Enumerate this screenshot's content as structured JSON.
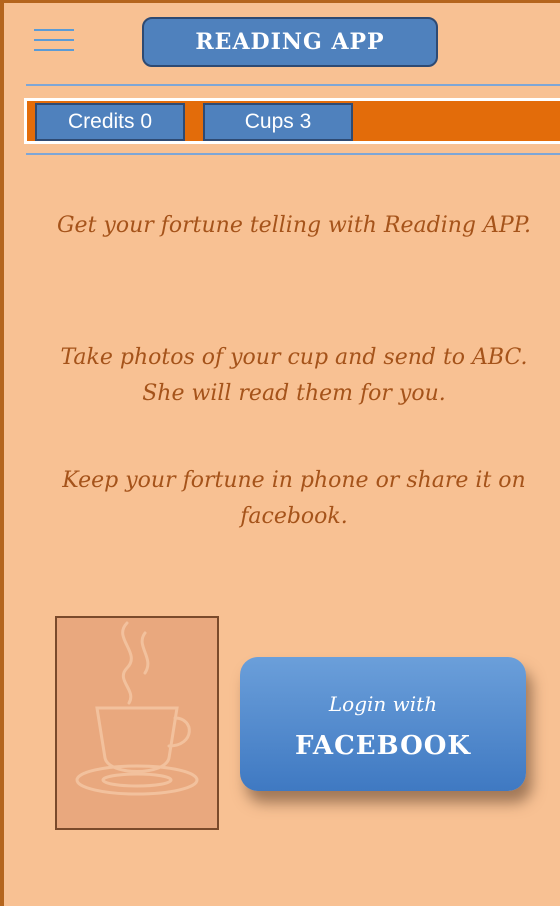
{
  "header": {
    "menu_icon": "hamburger-menu-icon",
    "title": "READING APP"
  },
  "stats": {
    "credits_label": "Credits 0",
    "cups_label": "Cups 3"
  },
  "intro": {
    "paragraph1": "Get your fortune telling with Reading APP.",
    "paragraph2": "Take photos of your cup and send to ABC. She will read them for you.",
    "paragraph3": "Keep your fortune in phone or share it on facebook."
  },
  "cup_thumbnail": {
    "icon": "coffee-cup-icon"
  },
  "login": {
    "line1": "Login with",
    "line2": "FACEBOOK"
  },
  "colors": {
    "background": "#f8c193",
    "accent_blue": "#4f81bd",
    "accent_orange": "#e36c0a",
    "text_brown": "#a5531a"
  }
}
